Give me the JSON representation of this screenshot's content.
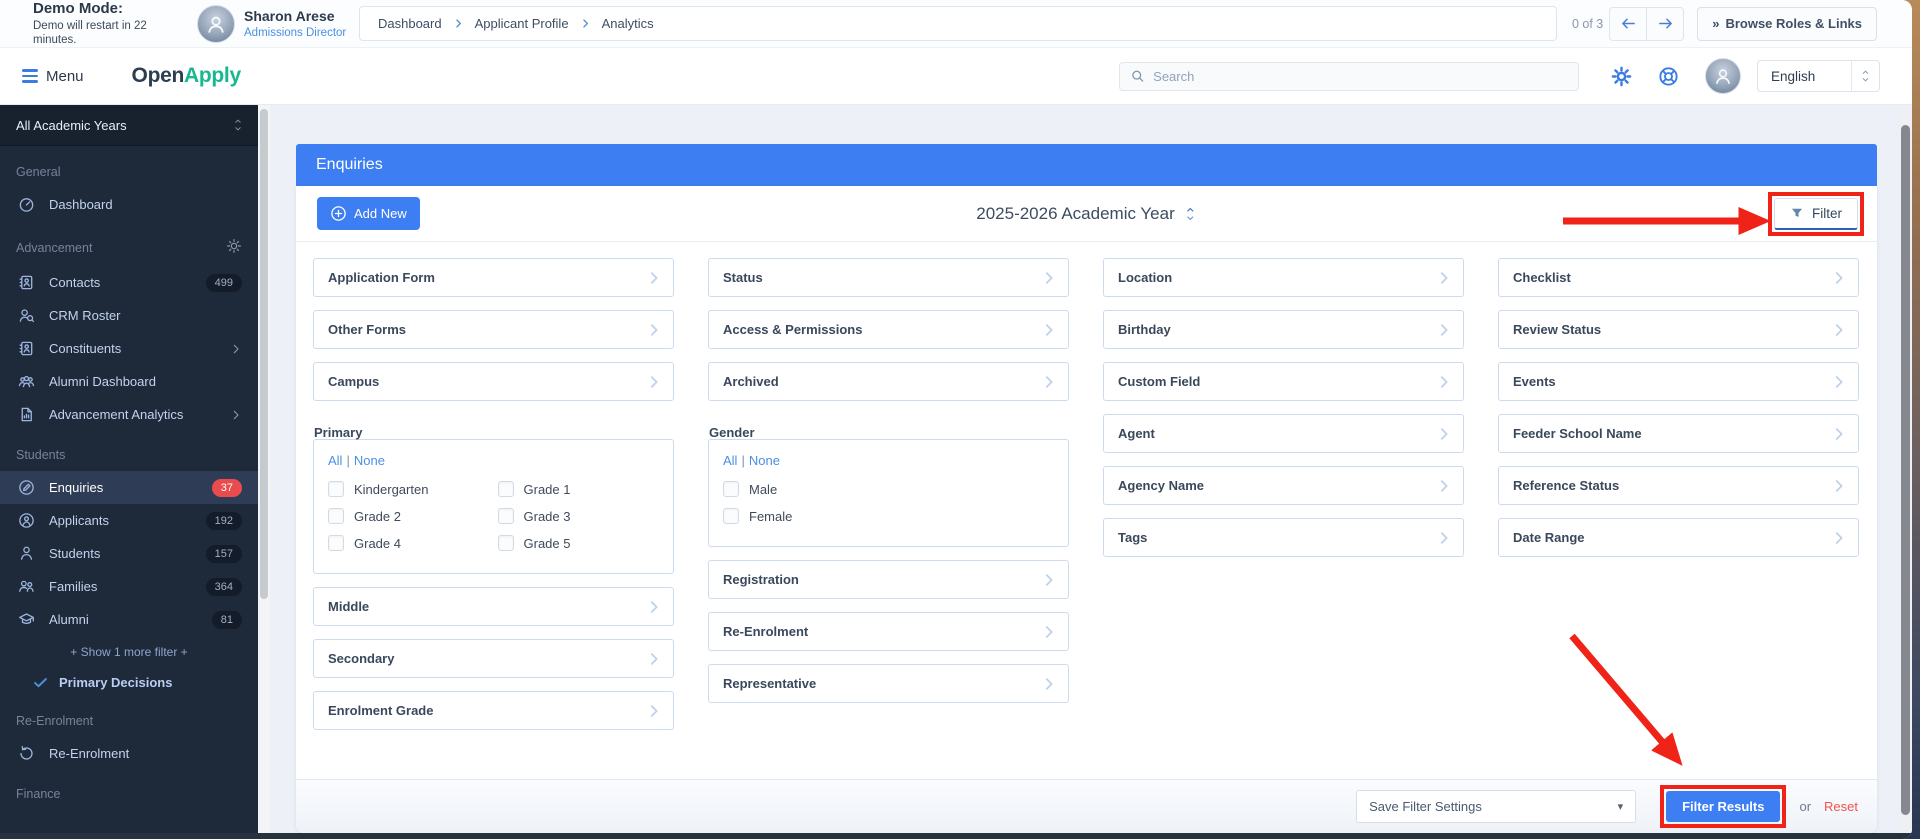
{
  "colors": {
    "accent_blue": "#3d7ef2",
    "logo_green": "#17b890",
    "sidebar_bg": "#1e2a3a",
    "badge_red": "#e84c4c",
    "highlight_red": "#ef2318",
    "link_blue": "#4a90e2",
    "reset_red": "#f2544d"
  },
  "top_bar": {
    "demo_title": "Demo Mode:",
    "demo_subtitle": "Demo will restart in 22 minutes.",
    "user_name": "Sharon Arese",
    "user_role": "Admissions Director",
    "breadcrumb": [
      "Dashboard",
      "Applicant Profile",
      "Analytics"
    ],
    "pagination": "0 of 3",
    "browse_glyph": "»",
    "browse_label": "Browse Roles & Links"
  },
  "menu_bar": {
    "menu_label": "Menu",
    "logo_part1": "Open",
    "logo_part2": "Apply",
    "search_placeholder": "Search",
    "language": "English"
  },
  "sidebar": {
    "year_selector": "All Academic Years",
    "sections": [
      {
        "label": "General",
        "items": [
          {
            "label": "Dashboard",
            "icon": "dashboard"
          }
        ]
      },
      {
        "label": "Advancement",
        "gear": true,
        "items": [
          {
            "label": "Contacts",
            "icon": "contacts",
            "badge": "499"
          },
          {
            "label": "CRM Roster",
            "icon": "crm-roster"
          },
          {
            "label": "Constituents",
            "icon": "constituents",
            "chevron": true
          },
          {
            "label": "Alumni Dashboard",
            "icon": "alumni-dashboard"
          },
          {
            "label": "Advancement Analytics",
            "icon": "advancement-analytics",
            "chevron": true
          }
        ]
      },
      {
        "label": "Students",
        "items": [
          {
            "label": "Enquiries",
            "icon": "enquiries",
            "badge": "37",
            "badge_style": "red",
            "active": true
          },
          {
            "label": "Applicants",
            "icon": "applicants",
            "badge": "192"
          },
          {
            "label": "Students",
            "icon": "students",
            "badge": "157"
          },
          {
            "label": "Families",
            "icon": "families",
            "badge": "364"
          },
          {
            "label": "Alumni",
            "icon": "alumni",
            "badge": "81"
          }
        ],
        "show_more": "+ Show 1 more filter +",
        "decision": "Primary Decisions"
      },
      {
        "label": "Re-Enrolment",
        "items": [
          {
            "label": "Re-Enrolment",
            "icon": "re-enrolment"
          }
        ]
      },
      {
        "label": "Finance",
        "items": []
      }
    ]
  },
  "main": {
    "title": "Enquiries",
    "add_new_label": "Add New",
    "year_selector": "2025-2026 Academic Year",
    "filter_button": "Filter",
    "filter_columns": [
      [
        {
          "kind": "select",
          "label": "Application Form"
        },
        {
          "kind": "select",
          "label": "Other Forms"
        },
        {
          "kind": "select",
          "label": "Campus"
        },
        {
          "kind": "group",
          "label": "Primary",
          "all_label": "All",
          "none_label": "None",
          "separator": "|",
          "columns": 2,
          "options": [
            "Kindergarten",
            "Grade 1",
            "Grade 2",
            "Grade 3",
            "Grade 4",
            "Grade 5"
          ]
        },
        {
          "kind": "select",
          "label": "Middle"
        },
        {
          "kind": "select",
          "label": "Secondary"
        },
        {
          "kind": "select",
          "label": "Enrolment Grade"
        }
      ],
      [
        {
          "kind": "select",
          "label": "Status"
        },
        {
          "kind": "select",
          "label": "Access & Permissions"
        },
        {
          "kind": "select",
          "label": "Archived"
        },
        {
          "kind": "group",
          "label": "Gender",
          "all_label": "All",
          "none_label": "None",
          "separator": "|",
          "columns": 1,
          "options": [
            "Male",
            "Female"
          ]
        },
        {
          "kind": "select",
          "label": "Registration"
        },
        {
          "kind": "select",
          "label": "Re-Enrolment"
        },
        {
          "kind": "select",
          "label": "Representative"
        }
      ],
      [
        {
          "kind": "select",
          "label": "Location"
        },
        {
          "kind": "select",
          "label": "Birthday"
        },
        {
          "kind": "select",
          "label": "Custom Field"
        },
        {
          "kind": "select",
          "label": "Agent"
        },
        {
          "kind": "select",
          "label": "Agency Name"
        },
        {
          "kind": "select",
          "label": "Tags"
        }
      ],
      [
        {
          "kind": "select",
          "label": "Checklist"
        },
        {
          "kind": "select",
          "label": "Review Status"
        },
        {
          "kind": "select",
          "label": "Events"
        },
        {
          "kind": "select",
          "label": "Feeder School Name"
        },
        {
          "kind": "select",
          "label": "Reference Status"
        },
        {
          "kind": "select",
          "label": "Date Range"
        }
      ]
    ],
    "footer": {
      "save_label": "Save Filter Settings",
      "filter_results_label": "Filter Results",
      "or_label": "or",
      "reset_label": "Reset"
    }
  }
}
